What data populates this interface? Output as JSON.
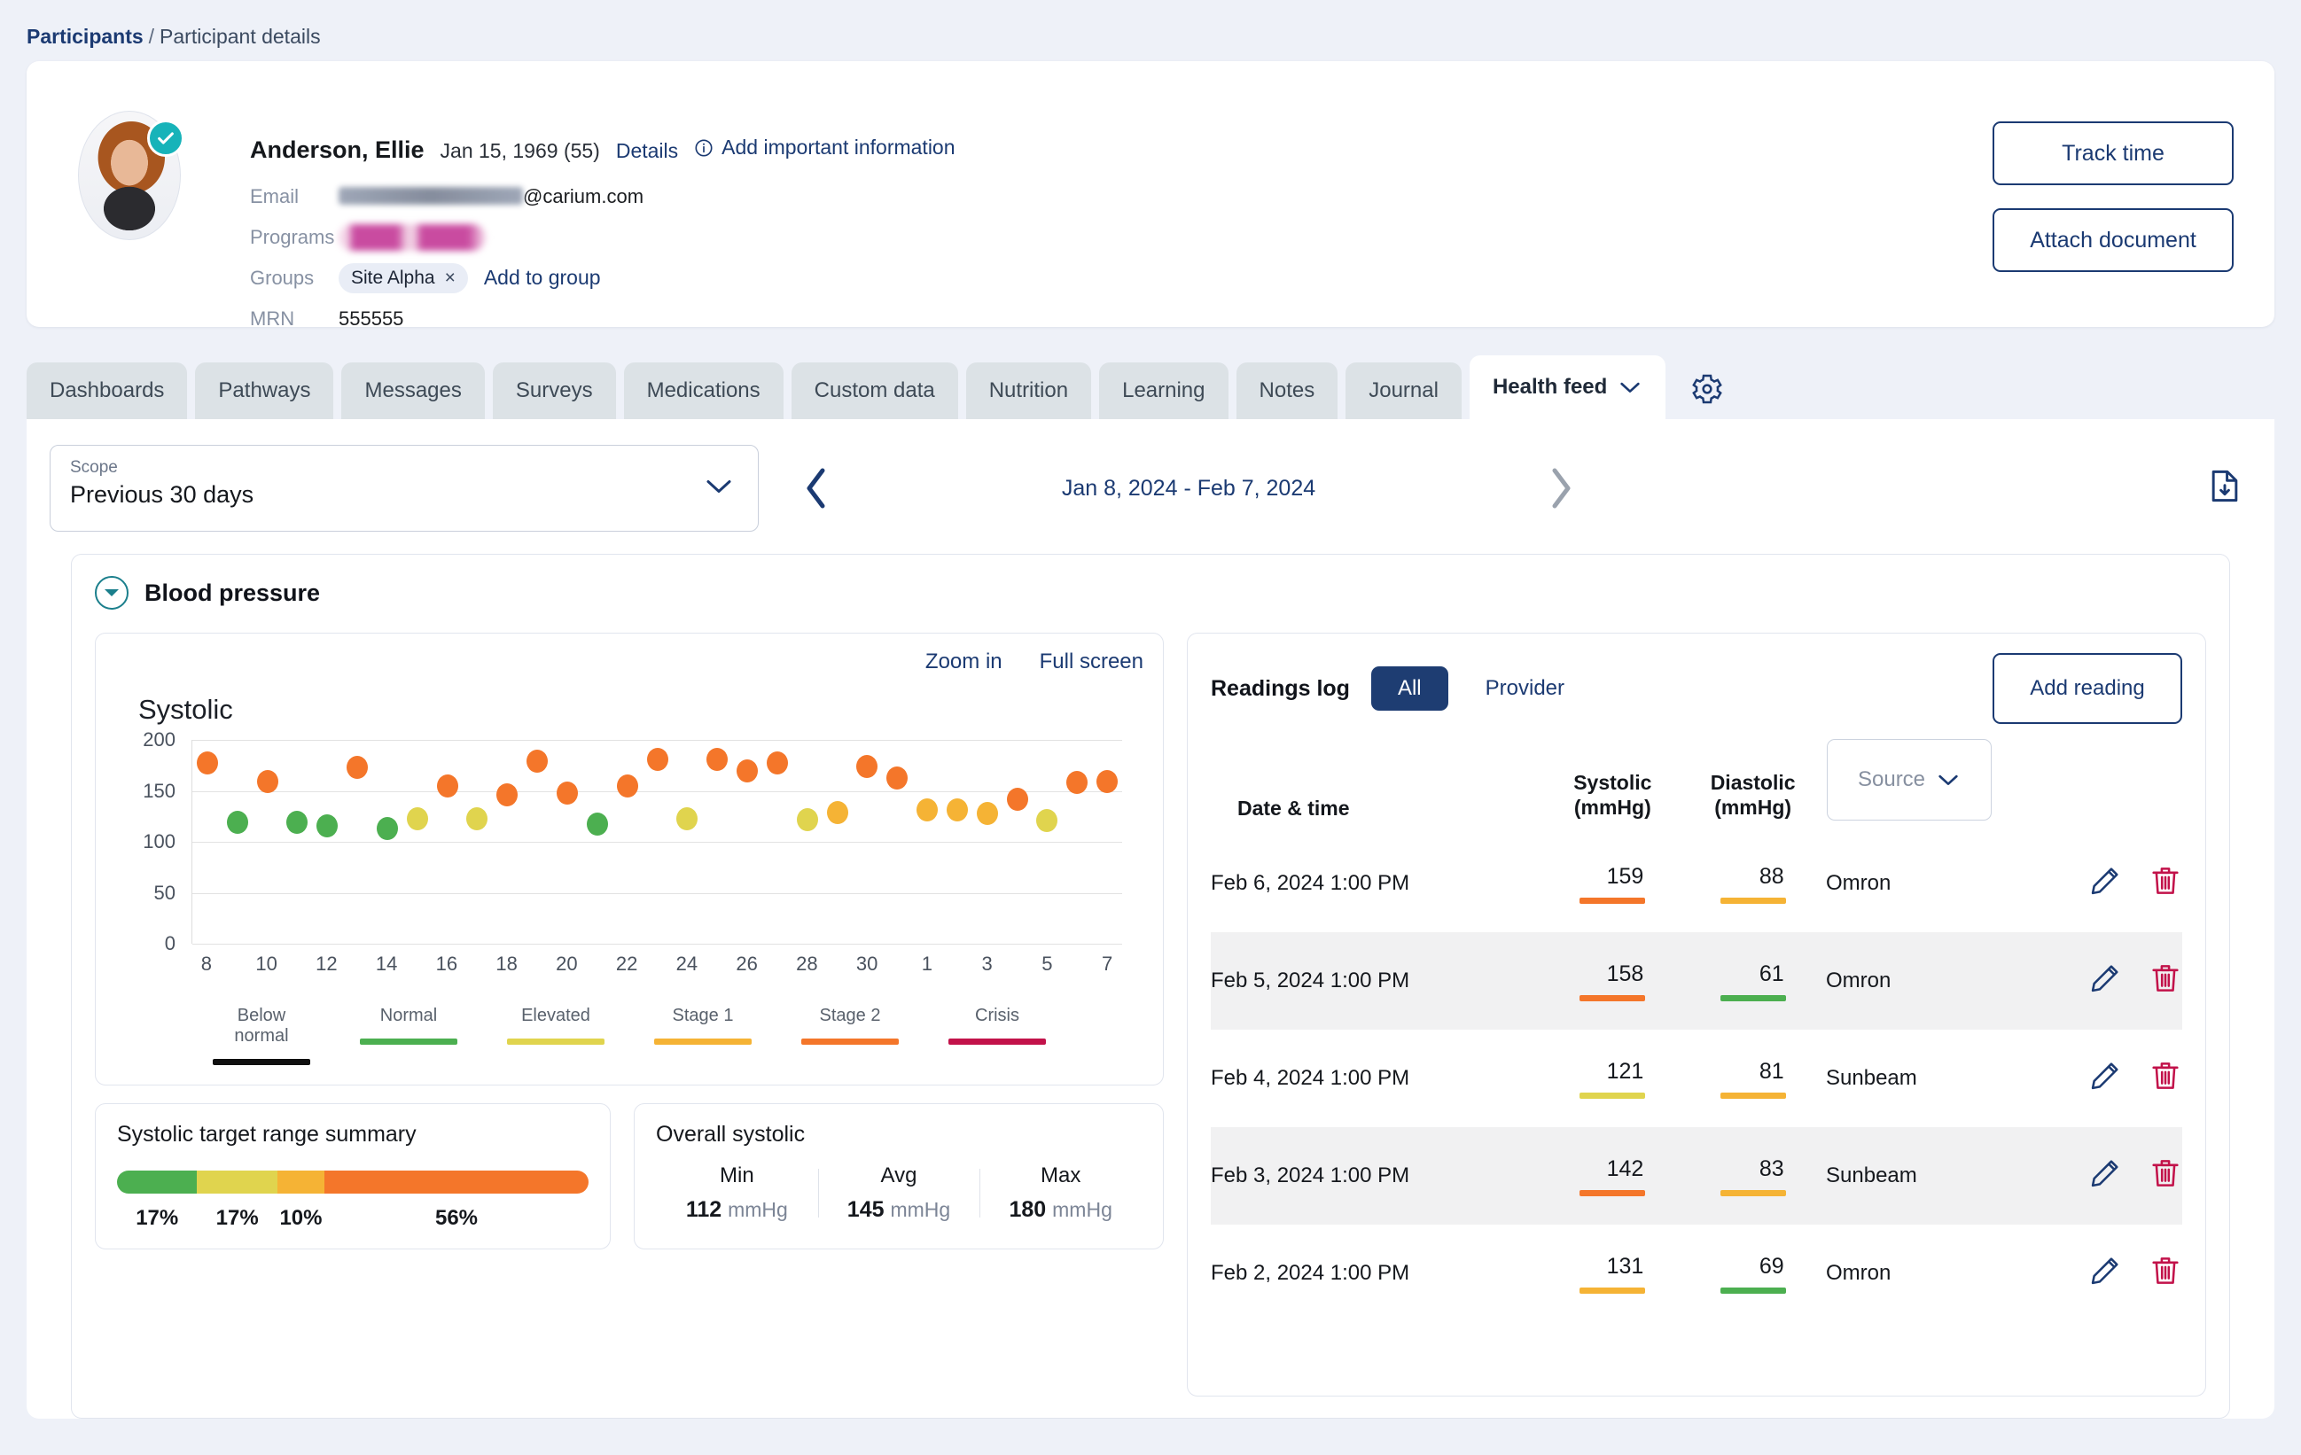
{
  "breadcrumb": {
    "root": "Participants",
    "sep": "/",
    "current": "Participant details"
  },
  "patient": {
    "name": "Anderson, Ellie",
    "dob": "Jan 15, 1969 (55)",
    "details_link": "Details",
    "add_info_link": "Add important information",
    "email_label": "Email",
    "email_domain": "@carium.com",
    "programs_label": "Programs",
    "groups_label": "Groups",
    "group_chip": "Site Alpha",
    "group_chip_remove": "×",
    "add_to_group": "Add to group",
    "mrn_label": "MRN",
    "mrn_value": "555555",
    "track_time": "Track time",
    "attach_document": "Attach document"
  },
  "tabs": [
    {
      "label": "Dashboards",
      "active": false
    },
    {
      "label": "Pathways",
      "active": false
    },
    {
      "label": "Messages",
      "active": false
    },
    {
      "label": "Surveys",
      "active": false
    },
    {
      "label": "Medications",
      "active": false
    },
    {
      "label": "Custom data",
      "active": false
    },
    {
      "label": "Nutrition",
      "active": false
    },
    {
      "label": "Learning",
      "active": false
    },
    {
      "label": "Notes",
      "active": false
    },
    {
      "label": "Journal",
      "active": false
    },
    {
      "label": "Health feed",
      "active": true
    }
  ],
  "scope": {
    "label": "Scope",
    "value": "Previous 30 days",
    "date_range": "Jan 8, 2024 - Feb 7, 2024"
  },
  "bp": {
    "title": "Blood pressure",
    "zoom_in": "Zoom in",
    "full_screen": "Full screen"
  },
  "chart_data": {
    "type": "scatter",
    "title": "Systolic",
    "xlabel": "",
    "ylabel": "",
    "ylim": [
      0,
      200
    ],
    "yticks": [
      0,
      50,
      100,
      150,
      200
    ],
    "xticks": [
      "8",
      "10",
      "12",
      "14",
      "16",
      "18",
      "20",
      "22",
      "24",
      "26",
      "28",
      "30",
      "1",
      "3",
      "5",
      "7"
    ],
    "x_start_day": 8,
    "grid": true,
    "legend_position": "bottom",
    "legend": [
      {
        "label": "Below normal",
        "color": "#101010"
      },
      {
        "label": "Normal",
        "color": "#4caf50"
      },
      {
        "label": "Elevated",
        "color": "#e0d44e"
      },
      {
        "label": "Stage 1",
        "color": "#f5b335"
      },
      {
        "label": "Stage 2",
        "color": "#f4762a"
      },
      {
        "label": "Crisis",
        "color": "#c2124a"
      }
    ],
    "points": [
      {
        "day": "8",
        "value": 177,
        "category": "Stage 2"
      },
      {
        "day": "9",
        "value": 119,
        "category": "Normal"
      },
      {
        "day": "10",
        "value": 159,
        "category": "Stage 2"
      },
      {
        "day": "11",
        "value": 119,
        "category": "Normal"
      },
      {
        "day": "12",
        "value": 116,
        "category": "Normal"
      },
      {
        "day": "13",
        "value": 173,
        "category": "Stage 2"
      },
      {
        "day": "14",
        "value": 113,
        "category": "Normal"
      },
      {
        "day": "15",
        "value": 123,
        "category": "Elevated"
      },
      {
        "day": "16",
        "value": 155,
        "category": "Stage 2"
      },
      {
        "day": "17",
        "value": 123,
        "category": "Elevated"
      },
      {
        "day": "18",
        "value": 146,
        "category": "Stage 2"
      },
      {
        "day": "19",
        "value": 179,
        "category": "Stage 2"
      },
      {
        "day": "20",
        "value": 148,
        "category": "Stage 2"
      },
      {
        "day": "21",
        "value": 117,
        "category": "Normal"
      },
      {
        "day": "22",
        "value": 155,
        "category": "Stage 2"
      },
      {
        "day": "23",
        "value": 181,
        "category": "Stage 2"
      },
      {
        "day": "24",
        "value": 123,
        "category": "Elevated"
      },
      {
        "day": "25",
        "value": 181,
        "category": "Stage 2"
      },
      {
        "day": "26",
        "value": 170,
        "category": "Stage 2"
      },
      {
        "day": "27",
        "value": 177,
        "category": "Stage 2"
      },
      {
        "day": "28",
        "value": 122,
        "category": "Elevated"
      },
      {
        "day": "29",
        "value": 129,
        "category": "Stage 1"
      },
      {
        "day": "30",
        "value": 174,
        "category": "Stage 2"
      },
      {
        "day": "31",
        "value": 163,
        "category": "Stage 2"
      },
      {
        "day": "1",
        "value": 131,
        "category": "Stage 1"
      },
      {
        "day": "2",
        "value": 131,
        "category": "Stage 1"
      },
      {
        "day": "3",
        "value": 128,
        "category": "Stage 1"
      },
      {
        "day": "4",
        "value": 142,
        "category": "Stage 2"
      },
      {
        "day": "5",
        "value": 121,
        "category": "Elevated"
      },
      {
        "day": "6",
        "value": 158,
        "category": "Stage 2"
      },
      {
        "day": "7",
        "value": 159,
        "category": "Stage 2"
      }
    ]
  },
  "range_summary": {
    "title": "Systolic target range summary",
    "segments": [
      {
        "pct": 17,
        "label": "17%",
        "color": "#4caf50"
      },
      {
        "pct": 17,
        "label": "17%",
        "color": "#e0d44e"
      },
      {
        "pct": 10,
        "label": "10%",
        "color": "#f5b335"
      },
      {
        "pct": 56,
        "label": "56%",
        "color": "#f4762a"
      }
    ]
  },
  "overall": {
    "title": "Overall systolic",
    "unit": "mmHg",
    "stats": [
      {
        "name": "Min",
        "value": "112"
      },
      {
        "name": "Avg",
        "value": "145"
      },
      {
        "name": "Max",
        "value": "180"
      }
    ]
  },
  "log": {
    "title": "Readings log",
    "filters": [
      {
        "label": "All",
        "active": true
      },
      {
        "label": "Provider",
        "active": false
      }
    ],
    "add_reading": "Add reading",
    "columns": {
      "date": "Date & time",
      "systolic_l1": "Systolic",
      "systolic_l2": "(mmHg)",
      "diastolic_l1": "Diastolic",
      "diastolic_l2": "(mmHg)",
      "source_placeholder": "Source"
    },
    "rows": [
      {
        "datetime": "Feb 6, 2024 1:00 PM",
        "systolic": "159",
        "systolic_color": "#f4762a",
        "diastolic": "88",
        "diastolic_color": "#f5b335",
        "source": "Omron"
      },
      {
        "datetime": "Feb 5, 2024 1:00 PM",
        "systolic": "158",
        "systolic_color": "#f4762a",
        "diastolic": "61",
        "diastolic_color": "#4caf50",
        "source": "Omron"
      },
      {
        "datetime": "Feb 4, 2024 1:00 PM",
        "systolic": "121",
        "systolic_color": "#e0d44e",
        "diastolic": "81",
        "diastolic_color": "#f5b335",
        "source": "Sunbeam"
      },
      {
        "datetime": "Feb 3, 2024 1:00 PM",
        "systolic": "142",
        "systolic_color": "#f4762a",
        "diastolic": "83",
        "diastolic_color": "#f5b335",
        "source": "Sunbeam"
      },
      {
        "datetime": "Feb 2, 2024 1:00 PM",
        "systolic": "131",
        "systolic_color": "#f5b335",
        "diastolic": "69",
        "diastolic_color": "#4caf50",
        "source": "Omron"
      }
    ]
  },
  "colors": {
    "brand_navy": "#1b3a72",
    "teal": "#17b3b9",
    "page_bg": "#eef1f8"
  }
}
